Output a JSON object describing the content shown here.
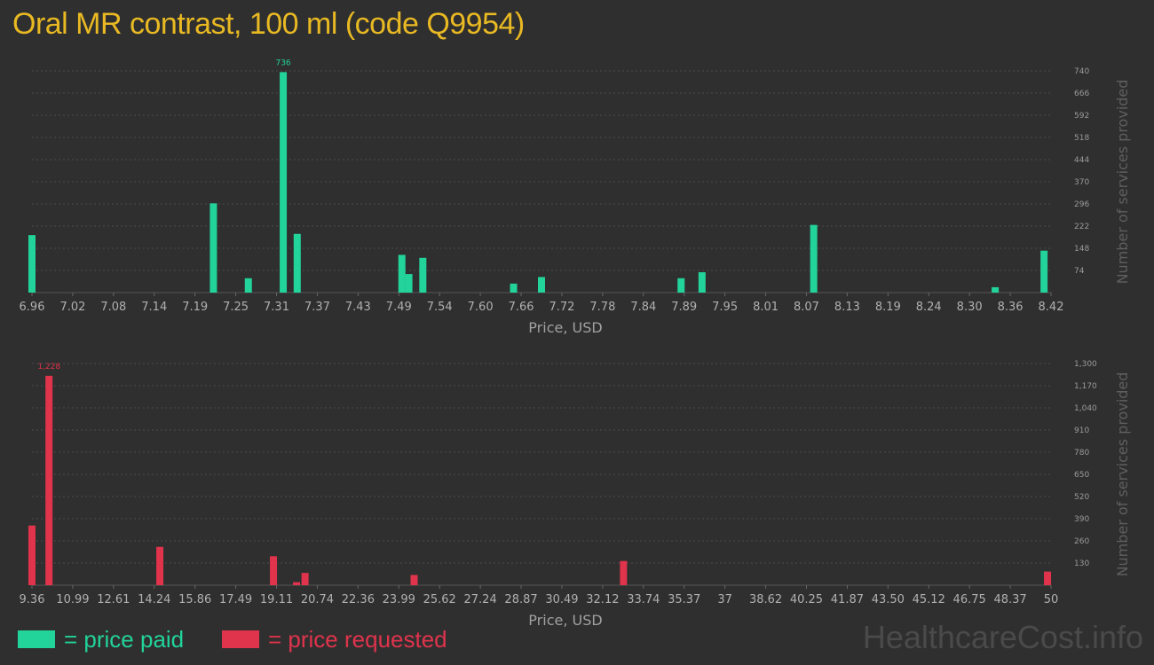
{
  "title": "Oral MR contrast, 100 ml (code Q9954)",
  "legend": {
    "paid": "= price paid",
    "requested": "= price requested"
  },
  "watermark": "HealthcareCost.info",
  "colors": {
    "paid": "#22d39a",
    "requested": "#e0334c",
    "title": "#e8b923",
    "background": "#2f2f2f"
  },
  "chart_data": [
    {
      "type": "bar",
      "series": [
        {
          "name": "price paid",
          "values": [
            192,
            298,
            48,
            736,
            196,
            126,
            62,
            116,
            30,
            52,
            48,
            68,
            226,
            18,
            140
          ]
        }
      ],
      "x": [
        6.96,
        7.22,
        7.27,
        7.32,
        7.34,
        7.49,
        7.5,
        7.52,
        7.65,
        7.69,
        7.89,
        7.92,
        8.08,
        8.34,
        8.41
      ],
      "x_tick_labels": [
        "6.96",
        "7.02",
        "7.08",
        "7.14",
        "7.19",
        "7.25",
        "7.31",
        "7.37",
        "7.43",
        "7.49",
        "7.54",
        "7.60",
        "7.66",
        "7.72",
        "7.78",
        "7.84",
        "7.89",
        "7.95",
        "8.01",
        "8.07",
        "8.13",
        "8.19",
        "8.24",
        "8.30",
        "8.36",
        "8.42"
      ],
      "y_tick_labels": [
        "74",
        "148",
        "222",
        "296",
        "370",
        "444",
        "518",
        "592",
        "666",
        "740"
      ],
      "xlabel": "Price, USD",
      "ylabel": "Number of services provided",
      "ylim": [
        0,
        740
      ],
      "xlim": [
        6.96,
        8.42
      ],
      "max_label": "736",
      "grid": true
    },
    {
      "type": "bar",
      "series": [
        {
          "name": "price requested",
          "values": [
            350,
            1228,
            225,
            170,
            18,
            72,
            60,
            142,
            80
          ]
        }
      ],
      "x": [
        9.36,
        10.04,
        14.46,
        18.99,
        19.91,
        20.25,
        24.6,
        32.95,
        49.86
      ],
      "x_tick_labels": [
        "9.36",
        "10.99",
        "12.61",
        "14.24",
        "15.86",
        "17.49",
        "19.11",
        "20.74",
        "22.36",
        "23.99",
        "25.62",
        "27.24",
        "28.87",
        "30.49",
        "32.12",
        "33.74",
        "35.37",
        "37",
        "38.62",
        "40.25",
        "41.87",
        "43.50",
        "45.12",
        "46.75",
        "48.37",
        "50"
      ],
      "y_tick_labels": [
        "130",
        "260",
        "390",
        "520",
        "650",
        "780",
        "910",
        "1,040",
        "1,170",
        "1,300"
      ],
      "xlabel": "Price, USD",
      "ylabel": "Number of services provided",
      "ylim": [
        0,
        1300
      ],
      "max_label": "1,228",
      "grid": true
    }
  ]
}
